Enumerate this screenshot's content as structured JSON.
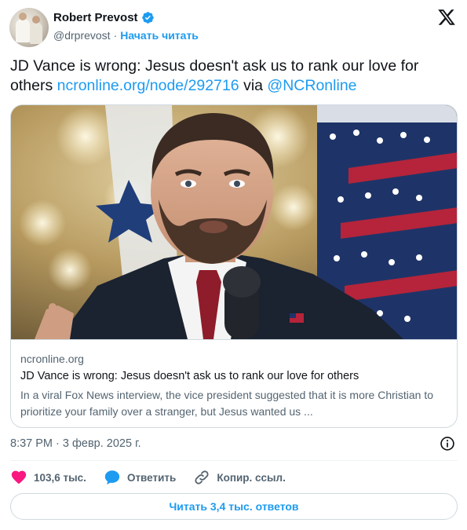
{
  "author": {
    "name": "Robert Prevost",
    "handle": "@drprevost",
    "separator": "·",
    "follow_label": "Начать читать"
  },
  "tweet": {
    "text_plain": "JD Vance is wrong: Jesus doesn't ask us to rank our love for others ",
    "link": "ncronline.org/node/292716",
    "via_word": " via ",
    "mention": "@NCRonline"
  },
  "card": {
    "domain": "ncronline.org",
    "title": "JD Vance is wrong: Jesus doesn't ask us to rank our love for others",
    "description": "In a viral Fox News interview, the vice president suggested that it is more Christian to prioritize your family over a stranger, but Jesus wanted us ..."
  },
  "meta": {
    "timestamp": "8:37 PM · 3 февр. 2025 г."
  },
  "actions": {
    "likes": "103,6 тыс.",
    "reply_label": "Ответить",
    "copy_label": "Копир. ссыл."
  },
  "read_replies_label": "Читать 3,4 тыс. ответов",
  "colors": {
    "accent": "#1d9bf0",
    "like": "#f91880",
    "text": "#0f1419",
    "secondary": "#536471",
    "border": "#cfd9de"
  },
  "icons": [
    "verified-badge-icon",
    "x-logo-icon",
    "info-icon",
    "heart-icon",
    "reply-bubble-icon",
    "link-icon"
  ]
}
